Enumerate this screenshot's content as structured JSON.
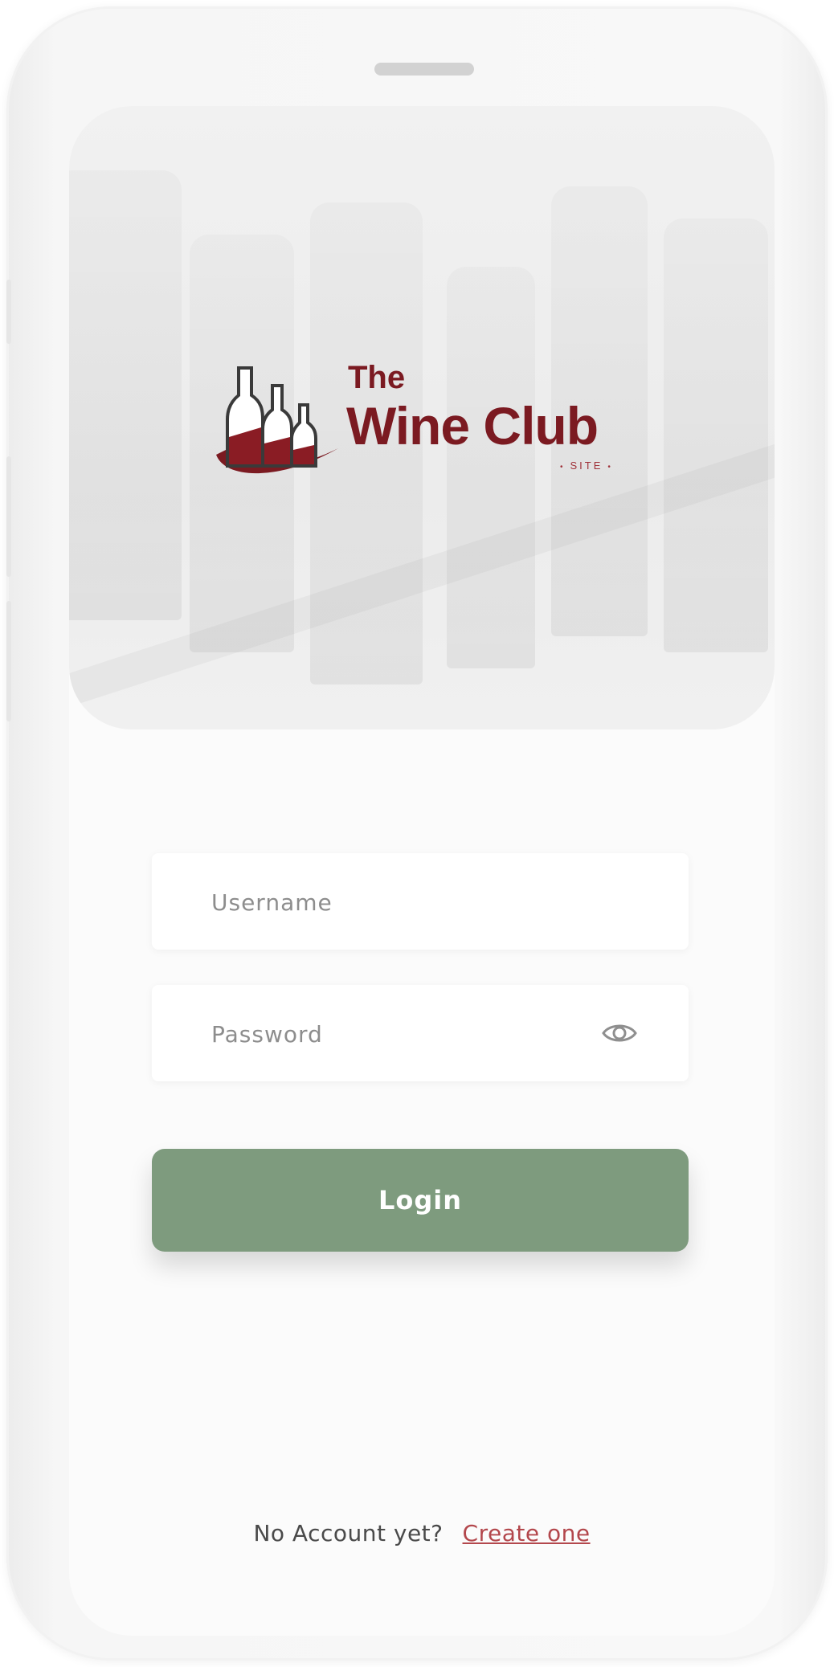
{
  "brand": {
    "line1": "The",
    "line2": "Wine Club",
    "tagline": "SITE",
    "color": "#7b1a21"
  },
  "form": {
    "username_placeholder": "Username",
    "username_value": "",
    "password_placeholder": "Password",
    "password_value": "",
    "password_toggle_icon": "eye-icon",
    "login_label": "Login",
    "login_color": "#7e9b7e"
  },
  "footer": {
    "prompt": "No Account yet?",
    "link_label": "Create one",
    "link_color": "#b3474c"
  }
}
